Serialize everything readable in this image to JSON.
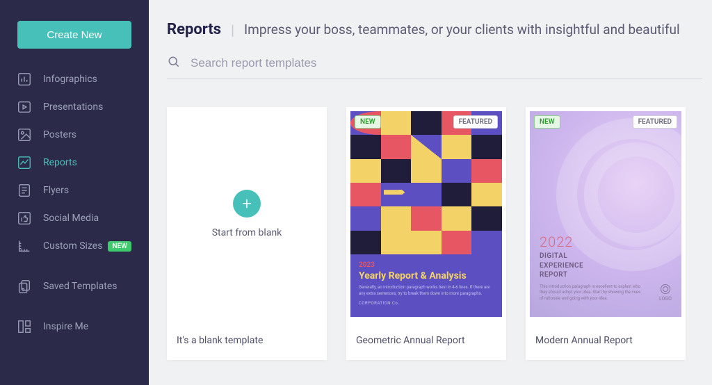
{
  "sidebar": {
    "create_label": "Create New",
    "items": [
      {
        "label": "Infographics",
        "icon": "bar-chart-icon",
        "active": false
      },
      {
        "label": "Presentations",
        "icon": "presentation-icon",
        "active": false
      },
      {
        "label": "Posters",
        "icon": "image-icon",
        "active": false
      },
      {
        "label": "Reports",
        "icon": "line-chart-icon",
        "active": true
      },
      {
        "label": "Flyers",
        "icon": "document-icon",
        "active": false
      },
      {
        "label": "Social Media",
        "icon": "thumbs-up-icon",
        "active": false
      },
      {
        "label": "Custom Sizes",
        "icon": "ruler-icon",
        "active": false,
        "badge": "NEW"
      }
    ],
    "secondary": [
      {
        "label": "Saved Templates",
        "icon": "bookmark-icon"
      }
    ],
    "tertiary": [
      {
        "label": "Inspire Me",
        "icon": "grid-icon"
      }
    ]
  },
  "header": {
    "title": "Reports",
    "tagline": "Impress your boss, teammates, or your clients with insightful and beautiful"
  },
  "search": {
    "placeholder": "Search report templates"
  },
  "badges": {
    "new": "NEW",
    "featured": "FEATURED"
  },
  "templates": [
    {
      "id": "blank",
      "title": "It's a blank template",
      "preview_label": "Start from blank"
    },
    {
      "id": "geometric",
      "title": "Geometric Annual Report",
      "new": true,
      "featured": true,
      "payload": {
        "year": "2023",
        "heading": "Yearly Report & Analysis",
        "desc": "Generally, an introduction paragraph works best in 4-6 lines. If there are any extra sentences, try to break them down into more paragraphs.",
        "corp": "CORPORATION Co."
      }
    },
    {
      "id": "modern",
      "title": "Modern Annual Report",
      "new": true,
      "featured": true,
      "payload": {
        "year": "2022",
        "heading_line1": "DIGITAL",
        "heading_line2": "EXPERIENCE",
        "heading_line3": "REPORT",
        "desc": "This introduction paragraph is excellent to explain who they should adopt your idea. Start by showing the cues of rationale and going with your idea.",
        "logo_text": "LOGO"
      }
    }
  ]
}
